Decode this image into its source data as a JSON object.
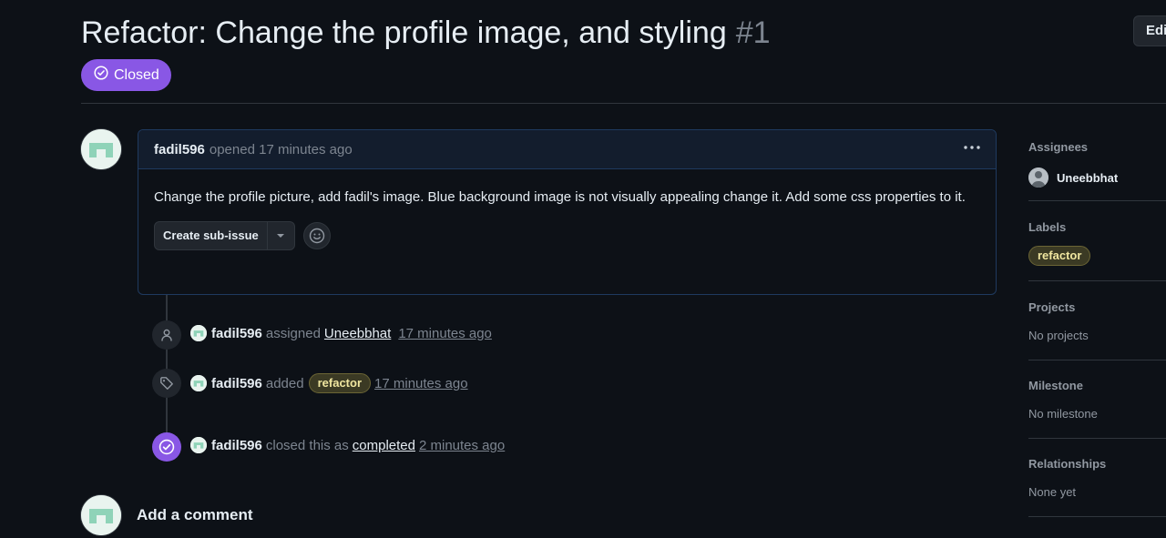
{
  "issue": {
    "title": "Refactor: Change the profile image, and styling",
    "number": "#1",
    "state": "Closed",
    "edit_label": "Edi"
  },
  "comment": {
    "author": "fadil596",
    "meta": "opened 17 minutes ago",
    "body": "Change the profile picture, add fadil's image. Blue background image is not visually appealing change it. Add some css properties to it.",
    "create_sub_issue_label": "Create sub-issue",
    "menu_icon": "kebab-horizontal-icon",
    "reaction_icon": "smiley-icon"
  },
  "timeline": [
    {
      "icon": "person-icon",
      "actor": "fadil596",
      "verb": "assigned",
      "target": "Uneebbhat",
      "time": "17 minutes ago"
    },
    {
      "icon": "tag-icon",
      "actor": "fadil596",
      "verb": "added",
      "label": "refactor",
      "time": "17 minutes ago"
    },
    {
      "icon": "check-circle-icon",
      "actor": "fadil596",
      "verb": "closed this as",
      "target": "completed",
      "time": "2 minutes ago"
    }
  ],
  "add_comment": {
    "heading": "Add a comment"
  },
  "sidebar": {
    "assignees": {
      "heading": "Assignees",
      "name": "Uneebbhat"
    },
    "labels": {
      "heading": "Labels",
      "items": [
        {
          "name": "refactor",
          "bg": "#3b3a24",
          "fg": "#f0e6a0",
          "border": "#6b6535"
        }
      ]
    },
    "projects": {
      "heading": "Projects",
      "value": "No projects"
    },
    "milestone": {
      "heading": "Milestone",
      "value": "No milestone"
    },
    "relationships": {
      "heading": "Relationships",
      "value": "None yet"
    }
  },
  "colors": {
    "background": "#0d1117",
    "closed": "#8957e5",
    "border": "#30363d",
    "comment_border": "#1f3a5f",
    "muted": "#7d8590"
  }
}
